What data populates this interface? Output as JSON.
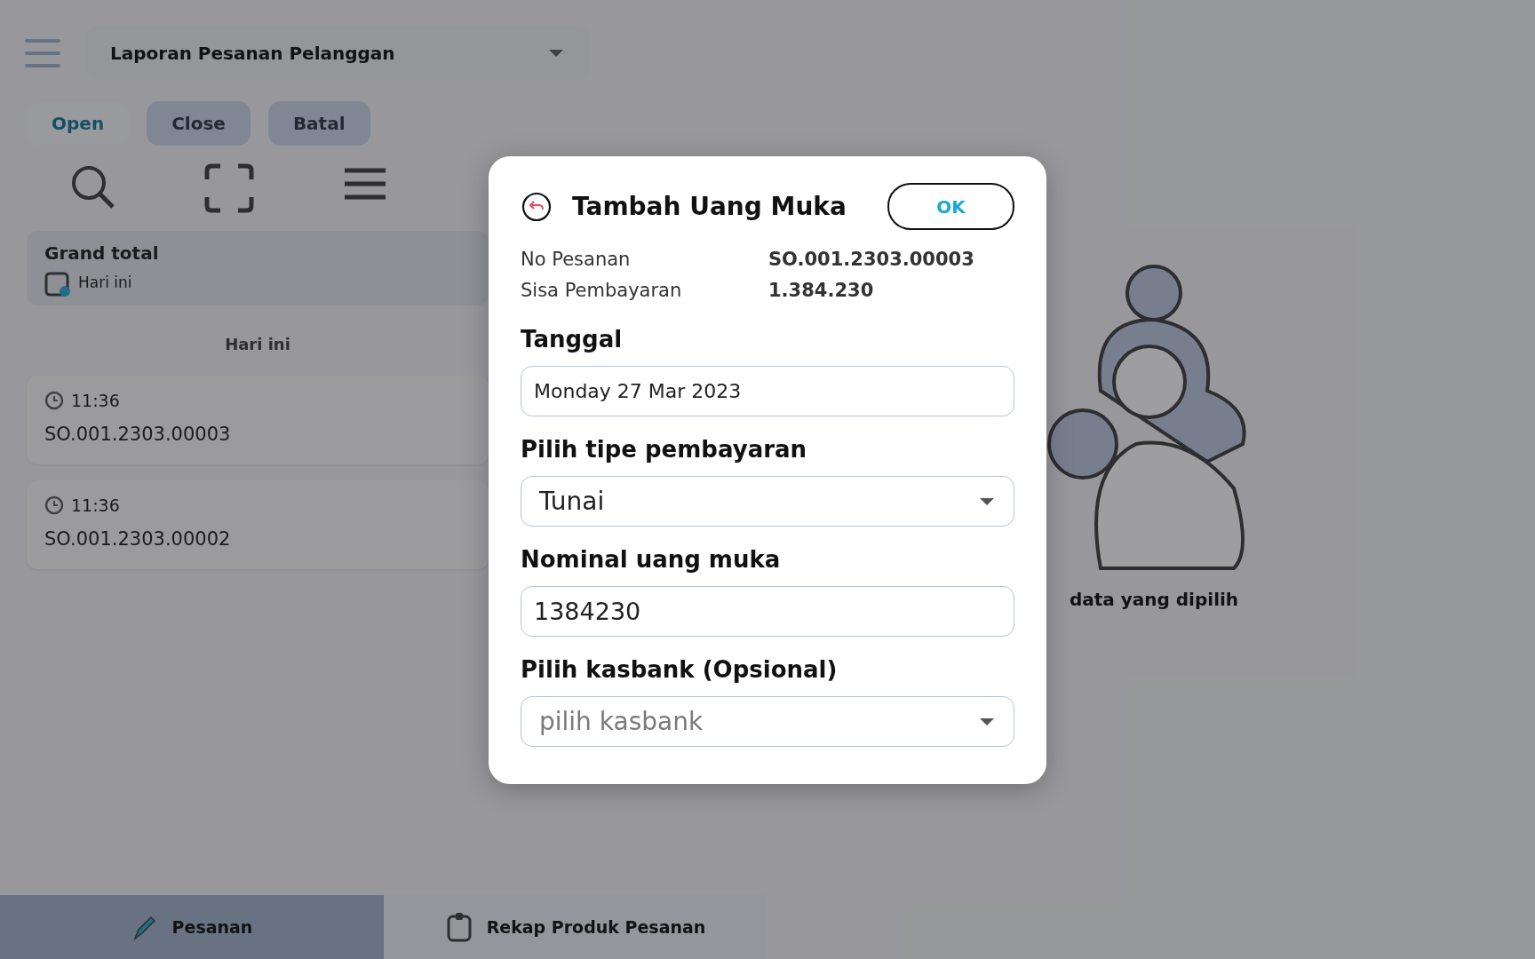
{
  "background": {
    "report_select": {
      "value": "Laporan Pesanan Pelanggan"
    },
    "tabs": [
      {
        "label": "Open",
        "selected": true
      },
      {
        "label": "Close",
        "selected": false
      },
      {
        "label": "Batal",
        "selected": false
      }
    ],
    "summary": {
      "title": "Grand total",
      "period": "Hari ini"
    },
    "section_header": "Hari ini",
    "orders": [
      {
        "time": "11:36",
        "number": "SO.001.2303.00003"
      },
      {
        "time": "11:36",
        "number": "SO.001.2303.00002"
      }
    ],
    "empty_message": "data yang dipilih",
    "bottom_nav": [
      {
        "label": "Pesanan",
        "selected": true
      },
      {
        "label": "Rekap Produk Pesanan",
        "selected": false
      }
    ]
  },
  "dialog": {
    "title": "Tambah Uang Muka",
    "ok_button": "OK",
    "info": [
      {
        "label": "No Pesanan",
        "value": "SO.001.2303.00003"
      },
      {
        "label": "Sisa Pembayaran",
        "value": "1.384.230"
      }
    ],
    "fields": [
      {
        "kind": "date",
        "label": "Tanggal",
        "value": "Monday 27 Mar 2023"
      },
      {
        "kind": "select",
        "label": "Pilih tipe pembayaran",
        "value": "Tunai"
      },
      {
        "kind": "text",
        "label": "Nominal uang muka",
        "value": "1384230"
      },
      {
        "kind": "select",
        "label": "Pilih kasbank (Opsional)",
        "placeholder": "pilih kasbank"
      }
    ]
  }
}
